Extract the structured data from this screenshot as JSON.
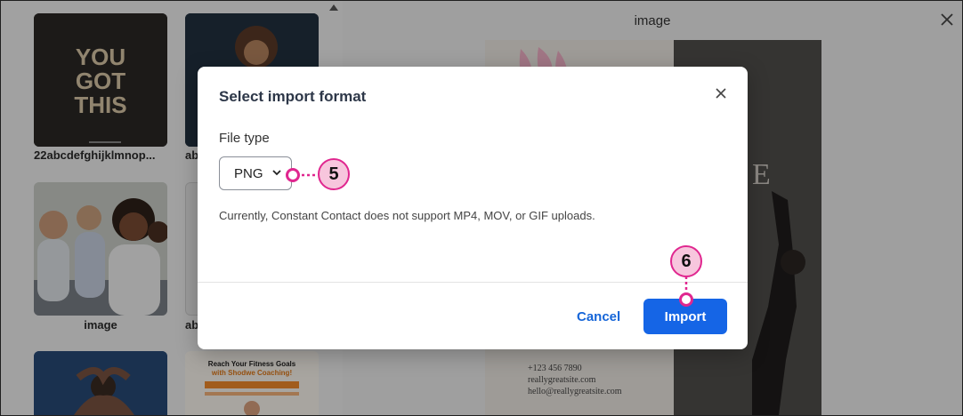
{
  "gallery": {
    "items": [
      {
        "label": "22abcdefghijklmnop...",
        "art_text": "YOU GOT THIS"
      },
      {
        "label": "ab"
      },
      {
        "label": "image"
      },
      {
        "label": "ab"
      },
      {
        "label": ""
      },
      {
        "label": "",
        "art_title": "Reach Your Fitness Goals",
        "art_subtitle": "with Shodwe Coaching!"
      }
    ]
  },
  "preview": {
    "title": "image",
    "poster_phone": "+123 456 7890",
    "poster_site": "reallygreatsite.com",
    "poster_email": "hello@reallygreatsite.com",
    "poster_letter": "E"
  },
  "dialog": {
    "title": "Select import format",
    "file_type_label": "File type",
    "file_type_value": "PNG",
    "note": "Currently, Constant Contact does not support MP4, MOV, or GIF uploads.",
    "cancel_label": "Cancel",
    "import_label": "Import"
  },
  "callouts": {
    "step_a": "5",
    "step_b": "6",
    "color": "#e0278f"
  },
  "colors": {
    "accent": "#1565e6",
    "link": "#1565d8"
  }
}
